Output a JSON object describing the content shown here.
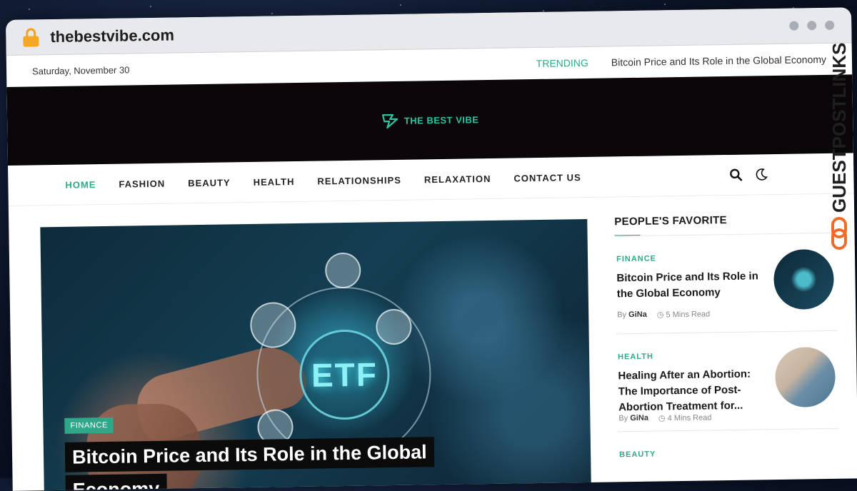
{
  "browser": {
    "url": "thebestvibe.com"
  },
  "topbar": {
    "date": "Saturday, November 30",
    "trending_label": "TRENDING",
    "trending_title": "Bitcoin Price and Its Role in the Global Economy"
  },
  "header": {
    "logo_text": "THE BEST VIBE"
  },
  "nav": {
    "items": [
      "HOME",
      "FASHION",
      "BEAUTY",
      "HEALTH",
      "RELATIONSHIPS",
      "RELAXATION",
      "CONTACT US"
    ],
    "active": "HOME"
  },
  "featured": {
    "category": "FINANCE",
    "title": "Bitcoin Price and Its Role in the Global Economy",
    "image_text": "ETF"
  },
  "sidebar": {
    "heading": "PEOPLE'S FAVORITE",
    "posts": [
      {
        "category": "FINANCE",
        "title": "Bitcoin Price and Its Role in the Global Economy",
        "by": "By",
        "author": "GiNa",
        "read_time": "5 Mins Read"
      },
      {
        "category": "HEALTH",
        "title": "Healing After an Abortion: The Importance of Post-Abortion Treatment for...",
        "by": "By",
        "author": "GiNa",
        "read_time": "4 Mins Read"
      },
      {
        "category": "BEAUTY"
      }
    ]
  },
  "watermark": {
    "text": "GUESTPOSTLINKS"
  },
  "colors": {
    "accent": "#2fa889",
    "header_bg": "#0a0609",
    "lock": "#f5a623",
    "watermark": "#1f1f1f",
    "watermark_icon": "#f06b2a"
  }
}
